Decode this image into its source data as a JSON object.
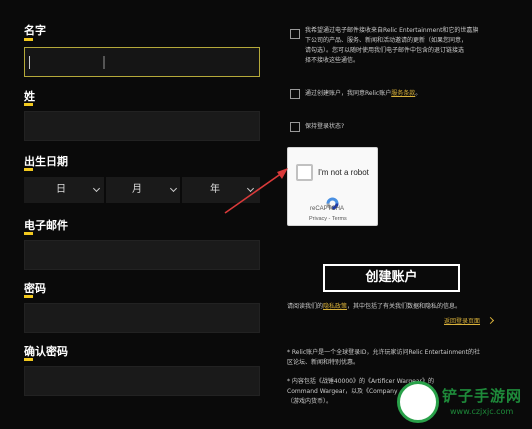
{
  "form": {
    "first_name": {
      "label": "名字",
      "value": ""
    },
    "last_name": {
      "label": "姓",
      "value": ""
    },
    "dob": {
      "label": "出生日期",
      "day": "日",
      "month": "月",
      "year": "年"
    },
    "email": {
      "label": "电子邮件",
      "value": ""
    },
    "password": {
      "label": "密码",
      "value": ""
    },
    "confirm_password": {
      "label": "确认密码",
      "value": ""
    }
  },
  "consents": {
    "marketing_text_1": "我希望通过电子邮件接收来自Relic Entertainment和它的世嘉旗",
    "marketing_text_2": "下公司的产品、服务、新闻和活动邀请的更新（如果您同意，",
    "marketing_text_3": "请勾选）。您可以随时使用我们电子邮件中包含的退订链接选",
    "marketing_text_4": "择不接收这些通信。",
    "terms_text": "通过创建账户，我同意Relic账户",
    "terms_link": "服务条款",
    "terms_suffix": "。",
    "stay_logged_in": "保持登录状态?"
  },
  "captcha": {
    "label": "I'm not a robot",
    "brand": "reCAPTCHA",
    "privacy": "Privacy",
    "separator": " - ",
    "terms": "Terms"
  },
  "actions": {
    "create_account": "创建账户",
    "privacy_prefix": "请阅读我们的",
    "privacy_link": "隐私政策",
    "privacy_suffix": "，其中包括了有关我们数据和隐私的信息。",
    "back_to_login": "返回登录页面"
  },
  "notes": {
    "n1_line1": "* Relic账户是一个全球登录ID，允许玩家访问Relic Entertainment的社",
    "n1_line2": "区论坛、新闻和特别优惠。",
    "n2_line1": "* 内容包括《战锤40000》的《Artificer Wargear》的",
    "n2_line2": "Command Wargear，以及《Company",
    "n2_line3": "（游戏内货币）。"
  },
  "watermark": {
    "text": "铲子手游网",
    "url": "www.czjxjc.com"
  },
  "colors": {
    "accent": "#f2c91f",
    "link": "#d9b13a",
    "background": "#0a0a0a",
    "field": "#1a1a1a"
  }
}
